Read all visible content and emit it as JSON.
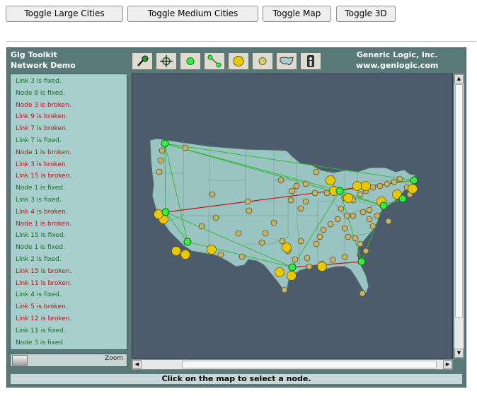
{
  "toolbar": {
    "toggle_large_cities": "Toggle Large Cities",
    "toggle_medium_cities": "Toggle Medium Cities",
    "toggle_map": "Toggle Map",
    "toggle_3d": "Toggle 3D"
  },
  "header": {
    "title_line1": "Glg Toolkit",
    "title_line2": "Network Demo",
    "company_line1": "Generic Logic, Inc.",
    "company_line2": "www.genlogic.com"
  },
  "tools": [
    "locate-icon",
    "crosshair-icon",
    "green-node-icon",
    "link-icon",
    "large-city-icon",
    "medium-city-icon",
    "map-icon",
    "info-icon"
  ],
  "log": [
    {
      "text": "Link 3 is fixed.",
      "status": "fixed"
    },
    {
      "text": "Node 8 is fixed.",
      "status": "fixed"
    },
    {
      "text": "Node 3 is broken.",
      "status": "broken"
    },
    {
      "text": "Link 9 is broken.",
      "status": "broken"
    },
    {
      "text": "Link 7 is broken.",
      "status": "broken"
    },
    {
      "text": "Link 7 is fixed.",
      "status": "fixed"
    },
    {
      "text": "Node 1 is broken.",
      "status": "broken"
    },
    {
      "text": "Link 3 is broken.",
      "status": "broken"
    },
    {
      "text": "Link 15 is broken.",
      "status": "broken"
    },
    {
      "text": "Node 1 is fixed.",
      "status": "fixed"
    },
    {
      "text": "Link 3 is fixed.",
      "status": "fixed"
    },
    {
      "text": "Link 4 is broken.",
      "status": "broken"
    },
    {
      "text": "Node 1 is broken.",
      "status": "broken"
    },
    {
      "text": "Link 15 is fixed.",
      "status": "fixed"
    },
    {
      "text": "Node 1 is fixed.",
      "status": "fixed"
    },
    {
      "text": "Link 2 is fixed.",
      "status": "fixed"
    },
    {
      "text": "Link 15 is broken.",
      "status": "broken"
    },
    {
      "text": "Link 11 is broken.",
      "status": "broken"
    },
    {
      "text": "Link 4 is fixed.",
      "status": "fixed"
    },
    {
      "text": "Link 5 is broken.",
      "status": "broken"
    },
    {
      "text": "Link 12 is broken.",
      "status": "broken"
    },
    {
      "text": "Link 11 is fixed.",
      "status": "fixed"
    },
    {
      "text": "Node 3 is fixed.",
      "status": "fixed"
    }
  ],
  "zoom_label": "Zoom",
  "status_text": "Click on the map to select a node.",
  "colors": {
    "panel_bg": "#597878",
    "log_bg": "#a9cece",
    "map_bg": "#4c5c6c",
    "land": "#9ac4c2",
    "fixed_text": "#10701f",
    "broken_text": "#b01515",
    "ok_link": "#33bb33",
    "broken_link": "#c02020",
    "node": "#33ee44",
    "large_city": "#e8c800",
    "medium_city": "#c4b464"
  }
}
